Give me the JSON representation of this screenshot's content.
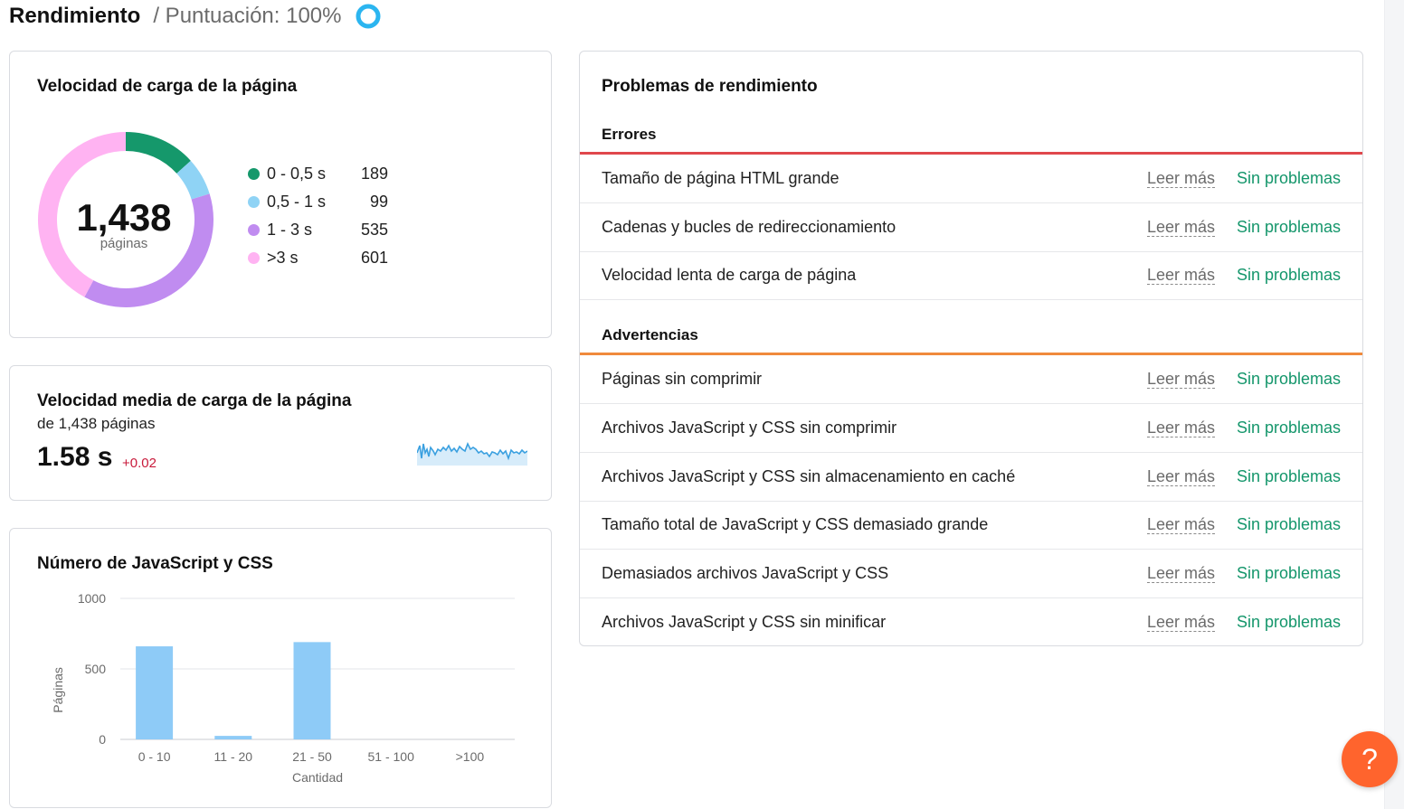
{
  "header": {
    "title": "Rendimiento",
    "subtitle": "/ Puntuación: 100%",
    "score_color": "#2bb5f0"
  },
  "load_speed": {
    "title": "Velocidad de carga de la página",
    "total": "1,438",
    "total_label": "páginas",
    "legend": [
      {
        "label": "0 - 0,5 s",
        "value": "189",
        "color": "#15986b"
      },
      {
        "label": "0,5 - 1 s",
        "value": "99",
        "color": "#8fd3f5"
      },
      {
        "label": "1 - 3 s",
        "value": "535",
        "color": "#c08cf0"
      },
      {
        "label": ">3 s",
        "value": "601",
        "color": "#ffb3f2"
      }
    ]
  },
  "avg_speed": {
    "title": "Velocidad media de carga de la página",
    "subtitle": "de 1,438 páginas",
    "value": "1.58 s",
    "delta": "+0.02",
    "sparkline_color": "#3aa0e0"
  },
  "js_css": {
    "title": "Número de JavaScript y CSS",
    "chart_data": {
      "type": "bar",
      "title": "Número de JavaScript y CSS",
      "categories": [
        "0 - 10",
        "11 - 20",
        "21 - 50",
        "51 - 100",
        ">100"
      ],
      "values": [
        660,
        25,
        690,
        0,
        0
      ],
      "xlabel": "Cantidad",
      "ylabel": "Páginas",
      "ylim": [
        0,
        1000
      ],
      "yticks": [
        "1000",
        "500",
        "0"
      ],
      "bar_color": "#8ecbf7",
      "grid": true
    }
  },
  "problems": {
    "title": "Problemas de rendimiento",
    "errors_label": "Errores",
    "errors_color": "#e0474c",
    "warnings_label": "Advertencias",
    "warnings_color": "#f08a3c",
    "link_label": "Leer más",
    "status_label": "Sin problemas",
    "errors": [
      "Tamaño de página HTML grande",
      "Cadenas y bucles de redireccionamiento",
      "Velocidad lenta de carga de página"
    ],
    "warnings": [
      "Páginas sin comprimir",
      "Archivos JavaScript y CSS sin comprimir",
      "Archivos JavaScript y CSS sin almacenamiento en caché",
      "Tamaño total de JavaScript y CSS demasiado grande",
      "Demasiados archivos JavaScript y CSS",
      "Archivos JavaScript y CSS sin minificar"
    ]
  },
  "help": {
    "label": "?",
    "icon": "help-icon"
  }
}
